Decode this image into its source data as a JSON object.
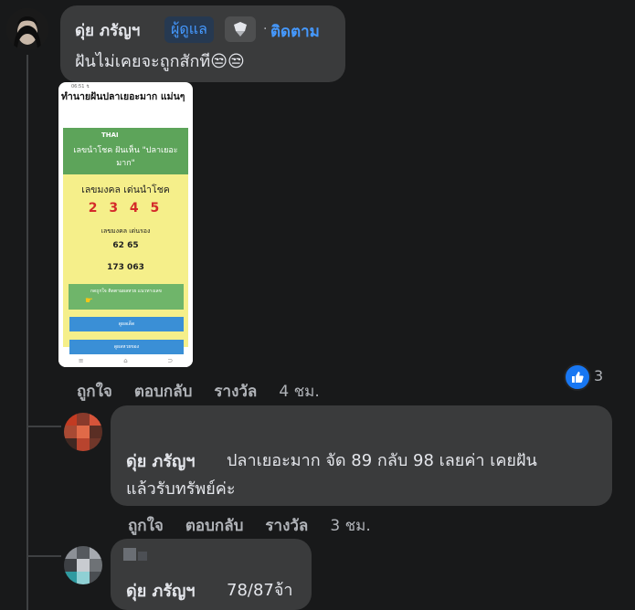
{
  "comment1": {
    "author": "ดุ่ย ภรัญฯ",
    "badge": "ผู้ดูแล",
    "dot": "·",
    "follow": "ติดตาม",
    "text": "ฝันไม่เคยจะถูกสักที😒😒",
    "actions": {
      "like": "ถูกใจ",
      "reply": "ตอบกลับ",
      "award": "รางวัล",
      "time": "4 ชม."
    },
    "reaction_count": "3",
    "attachment": {
      "status": "06:51 ↯",
      "headline": "ทำนายฝันปลาเยอะมาก แม่นๆ",
      "logo": "THAI",
      "green_text_1": "เลขนำโชค ฝันเห็น \"ปลาเยอะ",
      "green_text_2": "มาก\"",
      "lucky_title": "เลขมงคล เด่นนำโชค",
      "digits": "2 3 4 5",
      "sub_title": "เลขมงคล เด่นรอง",
      "pair": "62  65",
      "triple": "173  063",
      "green_button": "กดถูกใจ ติดตามผลหวย แนวทางเลข",
      "blue_button_1": "ดูผลเด็ด",
      "blue_button_2": "ดูผลหวยของ",
      "nav": [
        "≡",
        "⌂",
        "⊃"
      ]
    }
  },
  "reply1": {
    "author": "ดุ่ย ภรัญฯ",
    "text_line1": "ปลาเยอะมาก จัด 89 กลับ 98 เลยค่า เคยฝัน",
    "text_line2": "แล้วรับทรัพย์ค่ะ",
    "actions": {
      "like": "ถูกใจ",
      "reply": "ตอบกลับ",
      "award": "รางวัล",
      "time": "3 ชม."
    }
  },
  "reply2": {
    "author": "ดุ่ย ภรัญฯ",
    "text": "78/87จ้า"
  }
}
